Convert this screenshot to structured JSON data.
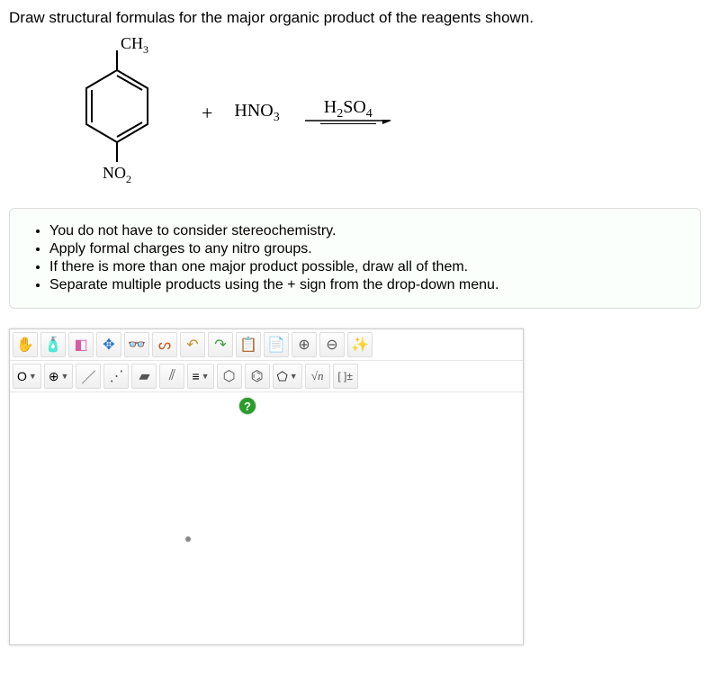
{
  "question": "Draw structural formulas for the major organic product of the reagents shown.",
  "reaction": {
    "reactant_labels": {
      "top": "CH",
      "top_sub": "3",
      "bottom": "NO",
      "bottom_sub": "2"
    },
    "plus": "+",
    "reagent": {
      "text": "HNO",
      "sub": "3"
    },
    "arrow_label": {
      "text": "H",
      "sub1": "2",
      "mid": "SO",
      "sub2": "4"
    }
  },
  "hints": [
    "You do not have to consider stereochemistry.",
    "Apply formal charges to any nitro groups.",
    "If there is more than one major product possible, draw all of them.",
    "Separate multiple products using the + sign from the drop-down menu."
  ],
  "toolbar_top": {
    "hand": "✋",
    "spray": "🧴",
    "eraser": "◧",
    "move": "✥",
    "glasses": "👓",
    "lasso": "ᔕ",
    "undo": "↶",
    "redo": "↷",
    "paste": "📋",
    "copy": "📄",
    "zoom_in": "⊕",
    "zoom_out": "⊖",
    "clean": "✨"
  },
  "toolbar_bottom": {
    "atom_label": "O",
    "charge_label": "⊕",
    "bond1": "／",
    "bond2": "⋰",
    "bond_bold": "▰",
    "bond_dash": "⫽",
    "bond_triple": "≡",
    "ring6": "⬡",
    "ring6b": "⌬",
    "ring5": "⬠",
    "sn_label": "√n",
    "bracket": "[ ]±"
  },
  "help": "?"
}
